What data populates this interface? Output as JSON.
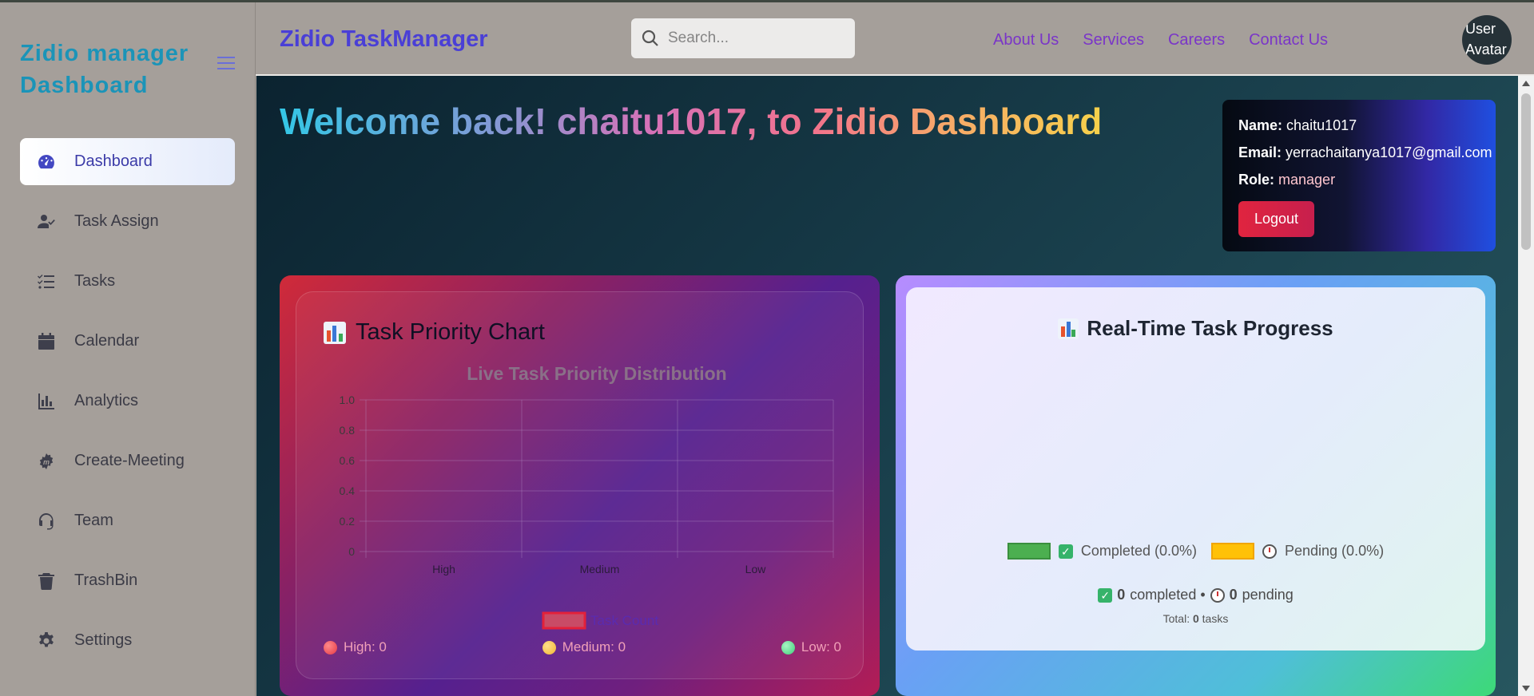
{
  "sidebar": {
    "brand": "Zidio manager Dashboard",
    "items": [
      {
        "label": "Dashboard",
        "icon": "gauge-icon"
      },
      {
        "label": "Task Assign",
        "icon": "user-check-icon"
      },
      {
        "label": "Tasks",
        "icon": "list-check-icon"
      },
      {
        "label": "Calendar",
        "icon": "calendar-icon"
      },
      {
        "label": "Analytics",
        "icon": "bar-chart-icon"
      },
      {
        "label": "Create-Meeting",
        "icon": "meeting-icon"
      },
      {
        "label": "Team",
        "icon": "headset-icon"
      },
      {
        "label": "TrashBin",
        "icon": "trash-icon"
      },
      {
        "label": "Settings",
        "icon": "gear-icon"
      }
    ]
  },
  "header": {
    "title": "Zidio TaskManager",
    "search_placeholder": "Search...",
    "links": [
      "About Us",
      "Services",
      "Careers",
      "Contact Us"
    ],
    "avatar_alt": "User Avatar"
  },
  "welcome": "Welcome back! chaitu1017, to Zidio Dashboard",
  "user": {
    "name_label": "Name:",
    "name": "chaitu1017",
    "email_label": "Email:",
    "email": "yerrachaitanya1017@gmail.com",
    "role_label": "Role:",
    "role": "manager",
    "logout": "Logout"
  },
  "priority_card": {
    "title": "Task Priority Chart",
    "stats": [
      {
        "label": "High: 0",
        "color": "#e53945"
      },
      {
        "label": "Medium: 0",
        "color": "#f2b632"
      },
      {
        "label": "Low: 0",
        "color": "#3fcf7a"
      }
    ]
  },
  "chart_data": {
    "type": "bar",
    "title": "Live Task Priority Distribution",
    "categories": [
      "High",
      "Medium",
      "Low"
    ],
    "series": [
      {
        "name": "Task Count",
        "values": [
          0,
          0,
          0
        ],
        "color": "#e3344a"
      }
    ],
    "yticks": [
      "1.0",
      "0.8",
      "0.6",
      "0.4",
      "0.2",
      "0"
    ],
    "ylim": [
      0,
      1
    ],
    "grid": true,
    "legend": "bottom"
  },
  "progress_card": {
    "title": "Real-Time Task Progress",
    "legend": [
      {
        "label": "Completed (0.0%)",
        "color": "#4caf50"
      },
      {
        "label": "Pending (0.0%)",
        "color": "#ffc107"
      }
    ],
    "completed_count": "0",
    "completed_text": "completed •",
    "pending_count": "0",
    "pending_text": "pending",
    "total_prefix": "Total:",
    "total_count": "0",
    "total_suffix": "tasks"
  }
}
